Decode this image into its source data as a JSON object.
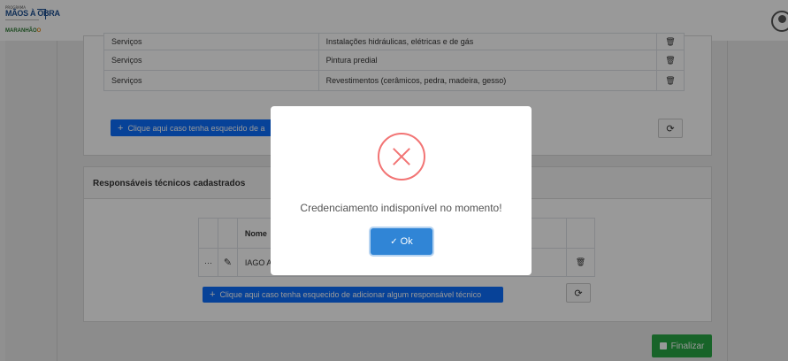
{
  "header": {
    "logo_small": "PROGRAMA",
    "logo_title": "MÃOS À OBRA",
    "logo_brand": "MARANHÃO",
    "logo_brand_extra": "O"
  },
  "services": {
    "rows": [
      {
        "category": "Serviços",
        "description": "Instalações hidráulicas, elétricas e de gás"
      },
      {
        "category": "Serviços",
        "description": "Pintura predial"
      },
      {
        "category": "Serviços",
        "description": "Revestimentos (cerâmicos, pedra, madeira, gesso)"
      }
    ],
    "add_label": "Clique aqui caso tenha esquecido de a"
  },
  "responsaveis": {
    "title": "Responsáveis técnicos cadastrados",
    "col_name": "Nome",
    "row_name": "IAGO A",
    "row_actions": "···",
    "add_label": "Clique aqui caso tenha esquecido de adicionar algum responsável técnico"
  },
  "footer": {
    "finalize_label": "Finalizar"
  },
  "modal": {
    "message": "Credenciamento indisponível no momento!",
    "ok_label": "Ok"
  },
  "icons": {
    "trash": "🗑",
    "refresh": "⟳",
    "edit": "✎",
    "check": "✓",
    "plus": "+"
  },
  "colors": {
    "primary": "#0d6efd",
    "success": "#28a745",
    "error_icon": "#f27474",
    "confirm": "#3085d6"
  }
}
